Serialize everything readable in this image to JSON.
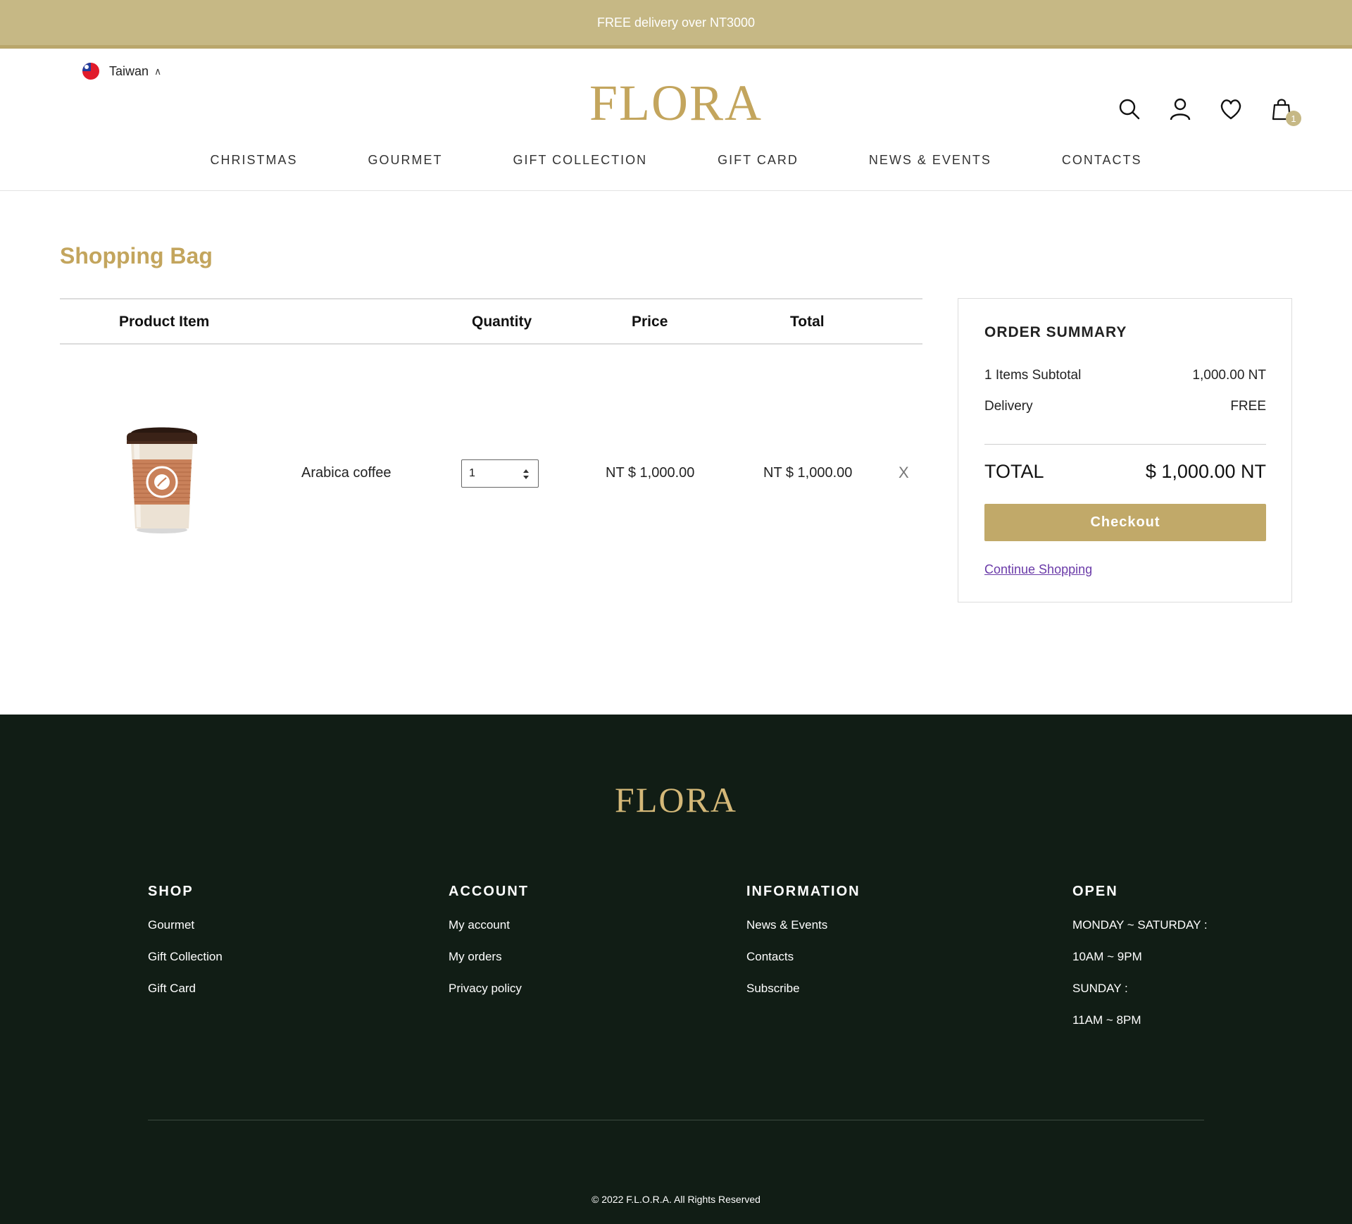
{
  "promo": {
    "text": "FREE delivery over NT3000"
  },
  "header": {
    "region": "Taiwan",
    "logo": "FLORA",
    "cart_count": "1",
    "nav": [
      "CHRISTMAS",
      "GOURMET",
      "GIFT COLLECTION",
      "GIFT CARD",
      "NEWS & EVENTS",
      "CONTACTS"
    ]
  },
  "page": {
    "title": "Shopping Bag"
  },
  "table": {
    "headers": {
      "product": "Product Item",
      "quantity": "Quantity",
      "price": "Price",
      "total": "Total"
    },
    "items": [
      {
        "name": "Arabica coffee",
        "quantity": "1",
        "price": "NT $ 1,000.00",
        "total": "NT $ 1,000.00",
        "remove": "X"
      }
    ]
  },
  "summary": {
    "title": "ORDER  SUMMARY",
    "subtitle_label": "1  Items Subtotal",
    "subtotal_value": "1,000.00  NT",
    "delivery_label": "Delivery",
    "delivery_value": "FREE",
    "total_label": "TOTAL",
    "total_value": "$  1,000.00  NT",
    "checkout_label": "Checkout",
    "continue_label": "Continue Shopping"
  },
  "footer": {
    "logo": "FLORA",
    "shop": {
      "title": "SHOP",
      "links": [
        "Gourmet",
        "Gift Collection",
        "Gift Card"
      ]
    },
    "account": {
      "title": "ACCOUNT",
      "links": [
        "My account",
        "My orders",
        "Privacy policy"
      ]
    },
    "information": {
      "title": "INFORMATION",
      "links": [
        "News & Events",
        "Contacts",
        "Subscribe"
      ]
    },
    "open": {
      "title": "OPEN",
      "lines": [
        "MONDAY ~ SATURDAY :",
        "10AM ~ 9PM",
        "SUNDAY :",
        "11AM ~ 8PM"
      ]
    },
    "copyright": "© 2022 F.L.O.R.A. All Rights Reserved"
  },
  "colors": {
    "gold": "#c3a55d",
    "promo_bg": "#c6b885",
    "footer_bg": "#111d15",
    "link": "#6a3aa8"
  },
  "icons": [
    "search-icon",
    "user-icon",
    "heart-icon",
    "bag-icon",
    "taiwan-flag-icon",
    "coffee-cup-image"
  ]
}
